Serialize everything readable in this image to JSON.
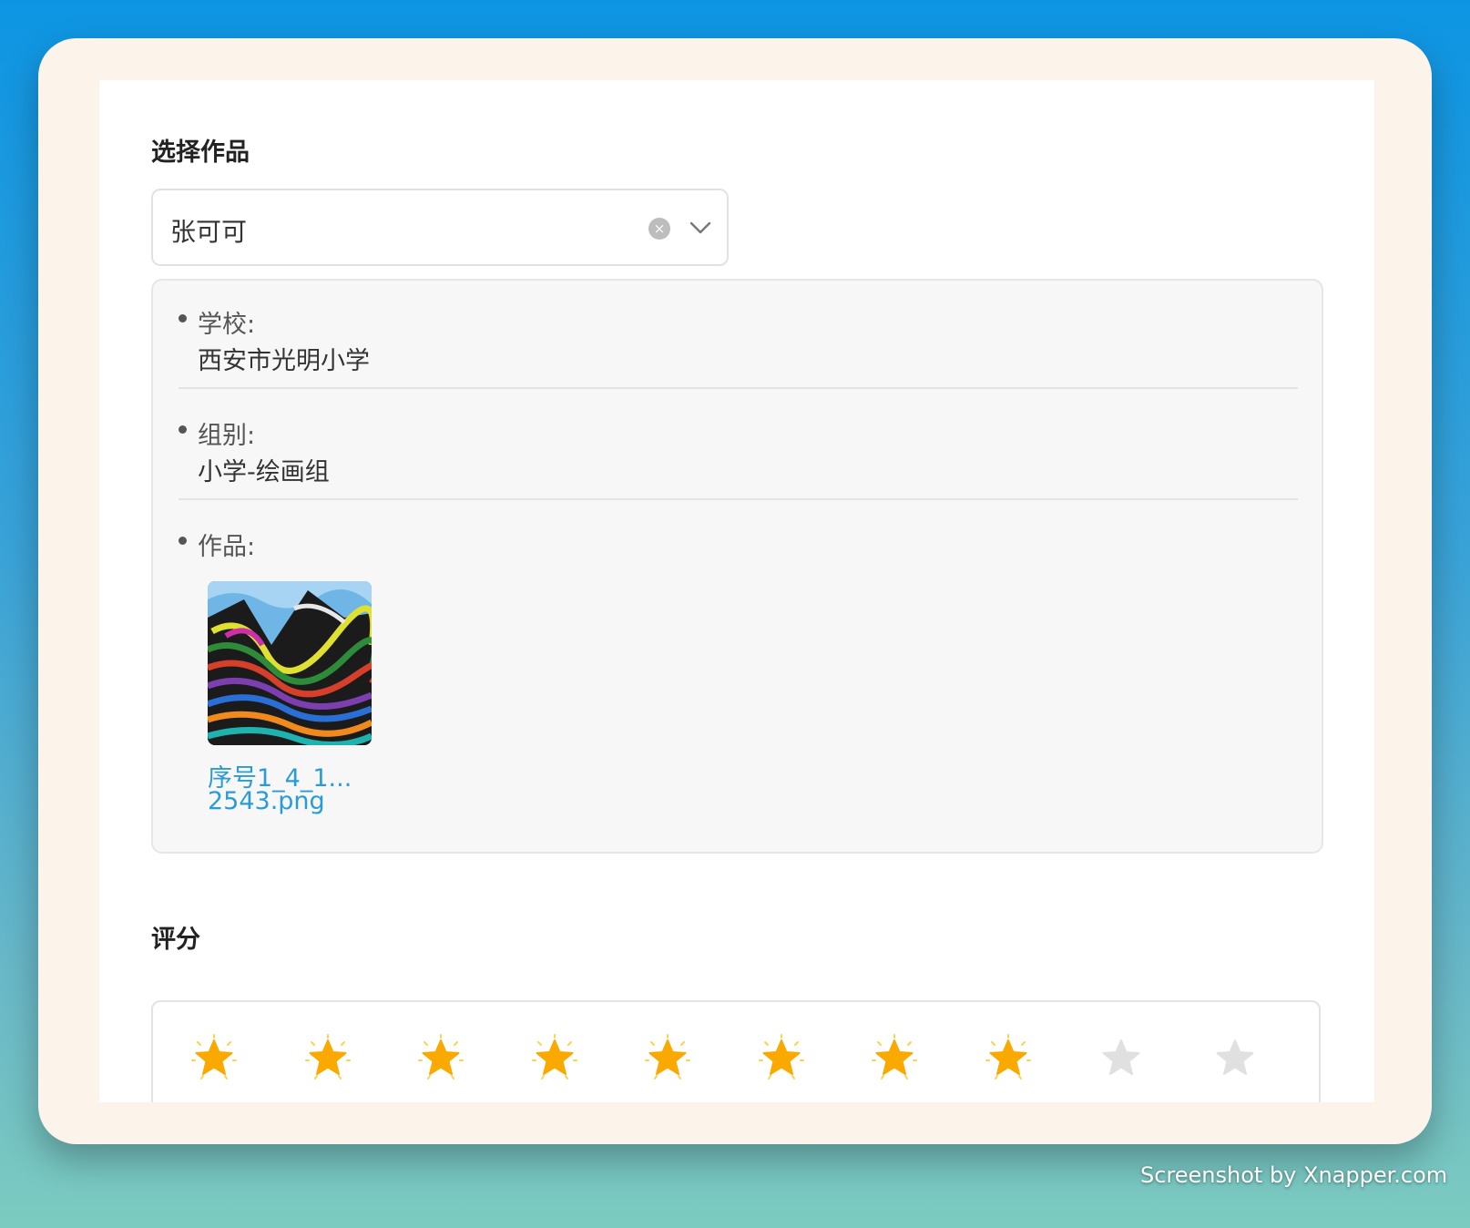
{
  "select_section": {
    "title": "选择作品",
    "selected_value": "张可可",
    "clear_icon": "×"
  },
  "info": {
    "school_label": "学校:",
    "school_value": "西安市光明小学",
    "group_label": "组别:",
    "group_value": "小学-绘画组",
    "work_label": "作品:",
    "file_name_line1": "序号1_4_1...",
    "file_name_line2": "2543.png"
  },
  "rating_section": {
    "title": "评分",
    "max_stars": 10,
    "filled_stars": 8
  },
  "watermark": "Screenshot by Xnapper.com",
  "colors": {
    "star_filled": "#f9a900",
    "star_empty": "#e0e0e0",
    "link": "#2a9bd6"
  }
}
